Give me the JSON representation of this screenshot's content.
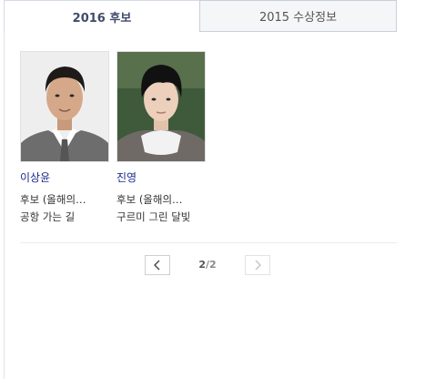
{
  "tabs": [
    {
      "label": "2016 후보",
      "active": true
    },
    {
      "label": "2015 수상정보",
      "active": false
    }
  ],
  "people": [
    {
      "name": "이상윤",
      "role": "후보 (올해의…",
      "work": "공항 가는 길"
    },
    {
      "name": "진영",
      "role": "후보 (올해의…",
      "work": "구르미 그린 달빛"
    }
  ],
  "pagination": {
    "current": "2",
    "separator": "/",
    "total": "2"
  },
  "icons": {
    "prev": "chevron-left-icon",
    "next": "chevron-right-icon"
  },
  "colors": {
    "name_link": "#1b2a8a",
    "tab_active_text": "#404b6b",
    "tab_inactive_bg": "#f5f6f8"
  }
}
